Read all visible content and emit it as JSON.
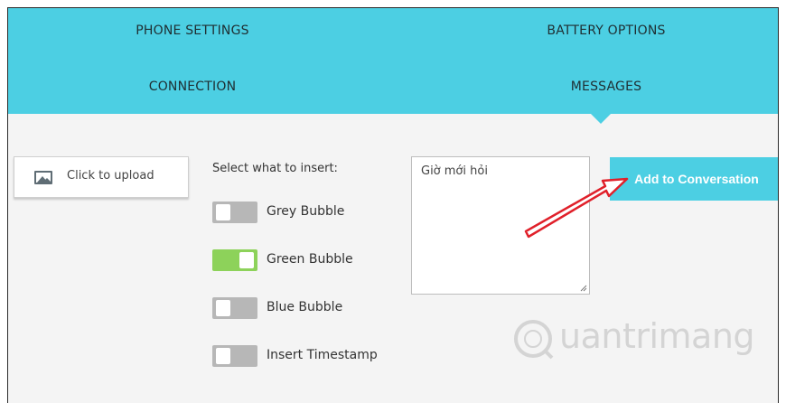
{
  "nav": {
    "tabs": [
      {
        "label": "PHONE SETTINGS"
      },
      {
        "label": "BATTERY OPTIONS"
      },
      {
        "label": "CONNECTION"
      },
      {
        "label": "MESSAGES"
      }
    ],
    "active_tab": "MESSAGES",
    "background_color": "#4ccfe3"
  },
  "upload": {
    "label": "Click to upload",
    "icon": "image-icon"
  },
  "insert": {
    "title": "Select what to insert:",
    "options": [
      {
        "label": "Grey Bubble",
        "on": false
      },
      {
        "label": "Green Bubble",
        "on": true
      },
      {
        "label": "Blue Bubble",
        "on": false
      },
      {
        "label": "Insert Timestamp",
        "on": false
      }
    ],
    "toggle_on_color": "#8dd25a",
    "toggle_off_color": "#b7b7b7"
  },
  "message": {
    "value": "Giờ mới hỏi"
  },
  "actions": {
    "add_label": "Add to Conversation"
  },
  "annotation": {
    "arrow_color": "#e0202a"
  },
  "watermark": {
    "text": "uantrimang"
  }
}
